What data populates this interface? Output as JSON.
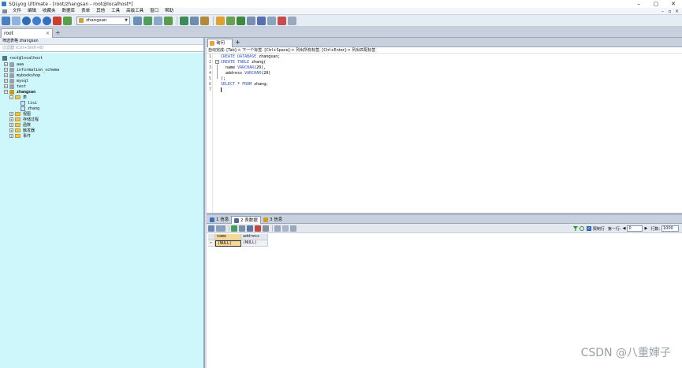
{
  "window": {
    "title": "SQLyog Ultimate - [root/zhangsan - root@localhost*]",
    "controls": [
      "–",
      "▢",
      "✕"
    ]
  },
  "menu": [
    "文件",
    "编辑",
    "收藏夹",
    "数据库",
    "表单",
    "其他",
    "工具",
    "高级工具",
    "窗口",
    "帮助"
  ],
  "toolbar": {
    "database_selected": "zhangsan"
  },
  "connection_tab": {
    "label": "root",
    "close": "×",
    "add": "+"
  },
  "object_browser": {
    "filter_label": "筛选表格 zhangsan",
    "filter_placeholder": "过滤器 (Ctrl+Shift+B)",
    "tree": [
      {
        "label": "root@localhost",
        "level": 0,
        "kind": "server"
      },
      {
        "label": "aaa",
        "level": 1,
        "kind": "db"
      },
      {
        "label": "information_schema",
        "level": 1,
        "kind": "db"
      },
      {
        "label": "mybookshop",
        "level": 1,
        "kind": "db"
      },
      {
        "label": "mysql",
        "level": 1,
        "kind": "db"
      },
      {
        "label": "test",
        "level": 1,
        "kind": "db"
      },
      {
        "label": "zhangsan",
        "level": 1,
        "kind": "db-active"
      },
      {
        "label": "表",
        "level": 2,
        "kind": "folder"
      },
      {
        "label": "lisi",
        "level": 3,
        "kind": "table"
      },
      {
        "label": "zhang",
        "level": 3,
        "kind": "table"
      },
      {
        "label": "视图",
        "level": 2,
        "kind": "folder"
      },
      {
        "label": "存储过程",
        "level": 2,
        "kind": "folder"
      },
      {
        "label": "函数",
        "level": 2,
        "kind": "folder"
      },
      {
        "label": "触发器",
        "level": 2,
        "kind": "folder"
      },
      {
        "label": "事件",
        "level": 2,
        "kind": "folder"
      }
    ]
  },
  "query": {
    "tab_label": "询问",
    "add": "+",
    "hint": "自动完成: [Tab]-> 下一个标签. [Ctrl+Space]-> 列出所有标签. [Ctrl+Enter]-> 列出匹配标签",
    "lines": [
      {
        "n": "1",
        "text": "CREATE DATABASE zhangsan;"
      },
      {
        "n": "2",
        "text": "CREATE TABLE zhang("
      },
      {
        "n": "3",
        "text": "  name VARCHAR(20),"
      },
      {
        "n": "4",
        "text": "  address VARCHAR(20)"
      },
      {
        "n": "5",
        "text": ");"
      },
      {
        "n": "6",
        "text": "SELECT * FROM zhang;"
      },
      {
        "n": "7",
        "text": ""
      }
    ]
  },
  "results": {
    "tabs": [
      "1 信息",
      "2 表数据",
      "3 信息"
    ],
    "read_only_label": "限制行",
    "first_row_label": "第一行:",
    "first_row_value": "0",
    "rows_label": "行数:",
    "rows_value": "1000",
    "columns": [
      "name",
      "address"
    ],
    "rows": [
      [
        "(NULL)",
        "(NULL)"
      ]
    ]
  },
  "watermark": "CSDN @八重婶子",
  "colors": {
    "tree_bg": "#cdf7fb",
    "keyword": "#3050c8",
    "selected": "#f6d896"
  }
}
